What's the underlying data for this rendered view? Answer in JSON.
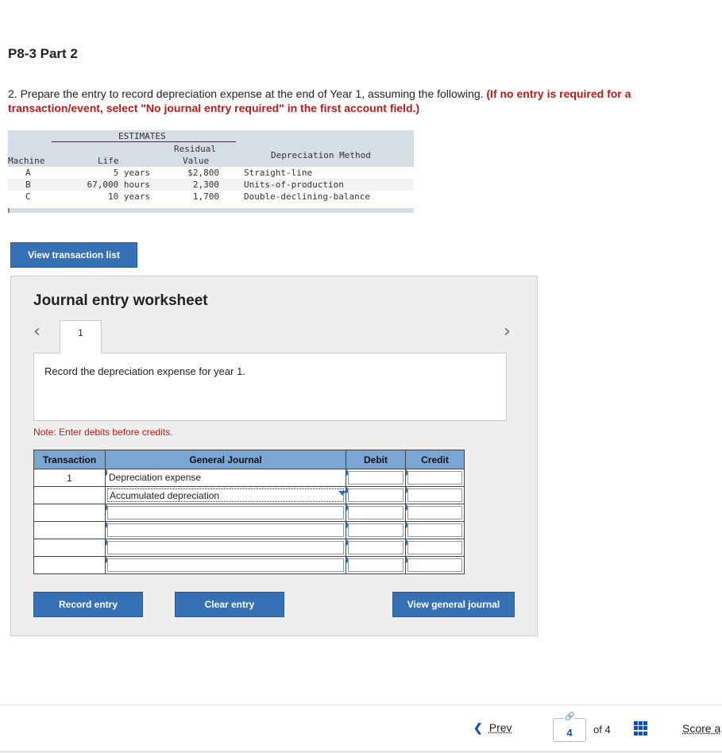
{
  "page": {
    "title": "P8-3 Part 2",
    "instruction_main": "2. Prepare the entry to record depreciation expense at the end of Year 1, assuming the following.",
    "instruction_required": "(If no entry is required for a transaction/event, select \"No journal entry required\" in the first account field.)"
  },
  "estimates": {
    "group_header": "ESTIMATES",
    "col_machine": "Machine",
    "col_life": "Life",
    "col_residual_1": "Residual",
    "col_residual_2": "Value",
    "col_method": "Depreciation Method",
    "rows": [
      {
        "machine": "A",
        "life": "5 years",
        "residual": "$2,800",
        "method": "Straight-line"
      },
      {
        "machine": "B",
        "life": "67,000 hours",
        "residual": "2,300",
        "method": "Units-of-production"
      },
      {
        "machine": "C",
        "life": "10 years",
        "residual": "1,700",
        "method": "Double-declining-balance"
      }
    ]
  },
  "buttons": {
    "view_transaction_list": "View transaction list",
    "record_entry": "Record entry",
    "clear_entry": "Clear entry",
    "view_general_journal": "View general journal"
  },
  "worksheet": {
    "title": "Journal entry worksheet",
    "tab_label": "1",
    "task_text": "Record the depreciation expense for year 1.",
    "note": "Note: Enter debits before credits."
  },
  "journal": {
    "headers": [
      "Transaction",
      "General Journal",
      "Debit",
      "Credit"
    ],
    "rows": [
      {
        "transaction": "1",
        "account": "Depreciation expense",
        "debit": "",
        "credit": ""
      },
      {
        "transaction": "",
        "account": "Accumulated depreciation",
        "debit": "",
        "credit": ""
      },
      {
        "transaction": "",
        "account": "",
        "debit": "",
        "credit": ""
      },
      {
        "transaction": "",
        "account": "",
        "debit": "",
        "credit": ""
      },
      {
        "transaction": "",
        "account": "",
        "debit": "",
        "credit": ""
      },
      {
        "transaction": "",
        "account": "",
        "debit": "",
        "credit": ""
      }
    ]
  },
  "footer": {
    "prev": "Prev",
    "page": "4",
    "of_text": "of 4",
    "score": "Score a"
  },
  "colors": {
    "button_blue": "#3670b5",
    "header_blue": "#7aa6d6",
    "required_red": "#b71c1c"
  }
}
